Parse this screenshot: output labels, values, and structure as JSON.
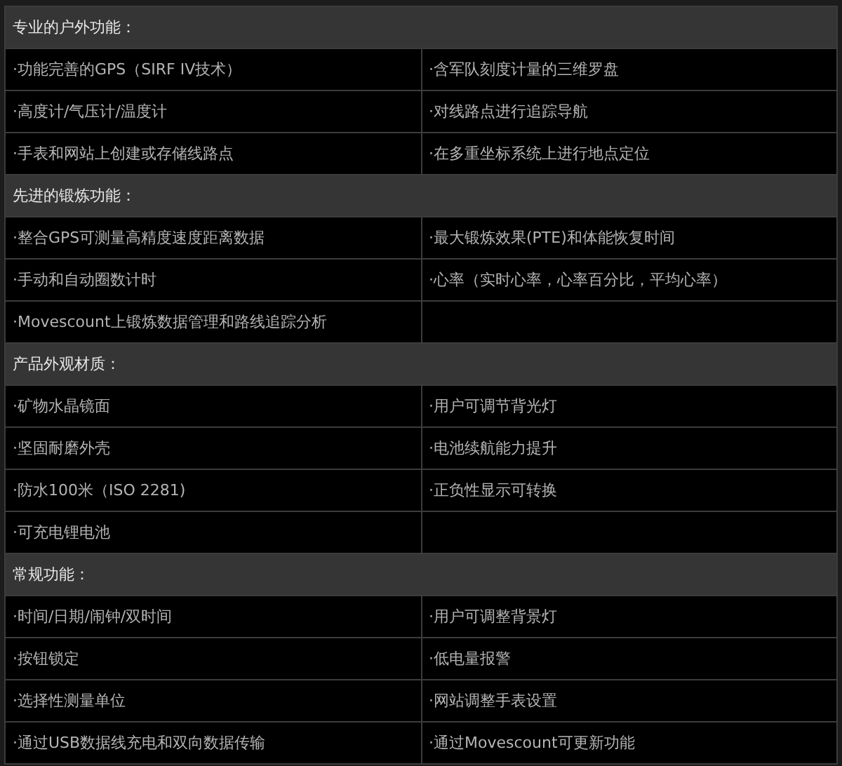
{
  "sections": [
    {
      "heading": "专业的户外功能：",
      "rows": [
        [
          "·功能完善的GPS（SIRF IV技术）",
          "·含军队刻度计量的三维罗盘"
        ],
        [
          "·高度计/气压计/温度计",
          "·对线路点进行追踪导航"
        ],
        [
          "·手表和网站上创建或存储线路点",
          "·在多重坐标系统上进行地点定位"
        ]
      ]
    },
    {
      "heading": "先进的锻炼功能：",
      "rows": [
        [
          "·整合GPS可测量高精度速度距离数据",
          "·最大锻炼效果(PTE)和体能恢复时间"
        ],
        [
          "·手动和自动圈数计时",
          "·心率（实时心率，心率百分比，平均心率）"
        ],
        [
          "·Movescount上锻炼数据管理和路线追踪分析"
        ]
      ]
    },
    {
      "heading": "产品外观材质：",
      "rows": [
        [
          "·矿物水晶镜面",
          "·用户可调节背光灯"
        ],
        [
          "·坚固耐磨外壳",
          "·电池续航能力提升"
        ],
        [
          "·防水100米（ISO 2281)",
          "·正负性显示可转换"
        ],
        [
          "·可充电锂电池"
        ]
      ]
    },
    {
      "heading": "常规功能：",
      "rows": [
        [
          "·时间/日期/闹钟/双时间",
          "·用户可调整背景灯"
        ],
        [
          "·按钮锁定",
          "·低电量报警"
        ],
        [
          "·选择性测量单位",
          "·网站调整手表设置"
        ],
        [
          "·通过USB数据线充电和双向数据传输",
          "·通过Movescount可更新功能"
        ]
      ]
    }
  ]
}
